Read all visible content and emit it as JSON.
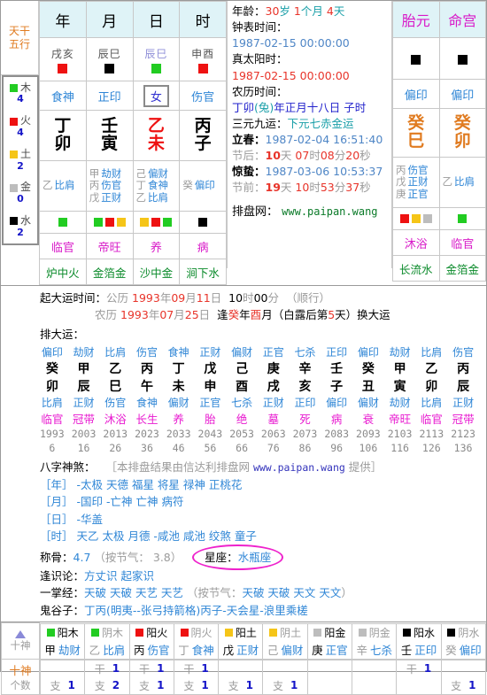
{
  "colors": {
    "wood": "#22cc22",
    "fire": "#ee1111",
    "earth": "#f5c518",
    "metal": "#bdbdbd",
    "water": "#000000",
    "accent_pink": "#ee22cc",
    "link_green": "#0a7a28"
  },
  "wuxing_header": {
    "line1": "天干",
    "line2": "五行"
  },
  "wuxing": [
    {
      "name": "木",
      "count": "4",
      "color": "#22cc22"
    },
    {
      "name": "火",
      "count": "4",
      "color": "#ee1111"
    },
    {
      "name": "土",
      "count": "2",
      "color": "#f5c518"
    },
    {
      "name": "金",
      "count": "0",
      "color": "#bdbdbd"
    },
    {
      "name": "水",
      "count": "2",
      "color": "#000000"
    }
  ],
  "pillars": {
    "headers": [
      "年",
      "月",
      "日",
      "时"
    ],
    "kongwang": [
      {
        "text": "戌亥",
        "color": "#ee1111",
        "highlight": false
      },
      {
        "text": "辰巳",
        "color": "#000000",
        "highlight": false
      },
      {
        "text": "辰巳",
        "color": "#22cc22",
        "highlight": true
      },
      {
        "text": "申酉",
        "color": "#ee1111",
        "highlight": false
      }
    ],
    "shishen": [
      "食神",
      "正印",
      "女",
      "伤官"
    ],
    "ganzhi": [
      {
        "gan": "丁",
        "zhi": "卯",
        "gan_color": "#000000",
        "zhi_color": "#000000"
      },
      {
        "gan": "壬",
        "zhi": "寅",
        "gan_color": "#000000",
        "zhi_color": "#000000"
      },
      {
        "gan": "乙",
        "zhi": "未",
        "gan_color": "#ee1111",
        "zhi_color": "#ee1111"
      },
      {
        "gan": "丙",
        "zhi": "子",
        "gan_color": "#000000",
        "zhi_color": "#000000"
      }
    ],
    "canggan": [
      [
        {
          "g": "乙",
          "s": "比肩"
        }
      ],
      [
        {
          "g": "甲",
          "s": "劫财"
        },
        {
          "g": "丙",
          "s": "伤官"
        },
        {
          "g": "戊",
          "s": "正财"
        }
      ],
      [
        {
          "g": "己",
          "s": "偏财"
        },
        {
          "g": "丁",
          "s": "食神"
        },
        {
          "g": "乙",
          "s": "比肩"
        }
      ],
      [
        {
          "g": "癸",
          "s": "偏印"
        }
      ]
    ],
    "marks": [
      [
        "#22cc22"
      ],
      [
        "#22cc22",
        "#ee1111",
        "#f5c518"
      ],
      [
        "#f5c518",
        "#ee1111",
        "#22cc22"
      ],
      [
        "#000000"
      ]
    ],
    "zhangsheng": [
      "临官",
      "帝旺",
      "养",
      "病"
    ],
    "nayin": [
      "炉中火",
      "金箔金",
      "沙中金",
      "涧下水"
    ]
  },
  "extra": {
    "headers": [
      "胎元",
      "命宫"
    ],
    "kongwang_colors": [
      "#000000",
      "#000000"
    ],
    "shishen": [
      "偏印",
      "偏印"
    ],
    "ganzhi": [
      {
        "gan": "癸",
        "zhi": "巳"
      },
      {
        "gan": "癸",
        "zhi": "卯"
      }
    ],
    "canggan": [
      [
        {
          "g": "丙",
          "s": "伤官"
        },
        {
          "g": "戊",
          "s": "正财"
        },
        {
          "g": "庚",
          "s": "正官"
        }
      ],
      [
        {
          "g": "乙",
          "s": "比肩"
        }
      ]
    ],
    "marks": [
      [
        "#ee1111",
        "#f5c518",
        "#bdbdbd"
      ],
      [
        "#22cc22"
      ]
    ],
    "zhangsheng": [
      "沐浴",
      "临官"
    ],
    "nayin": [
      "长流水",
      "金箔金"
    ]
  },
  "info": {
    "age_label": "年龄：",
    "age_years": "30",
    "age_years_unit": "岁",
    "age_months": "1",
    "age_months_unit": "个月",
    "age_days": "4",
    "age_days_unit": "天",
    "clock_label": "钟表时间：",
    "clock_value": "1987-02-15 00:00:00",
    "solar_label": "真太阳时：",
    "solar_value": "1987-02-15 00:00:00",
    "lunar_label": "农历时间：",
    "lunar_gz": "丁卯",
    "lunar_zodiac": "(兔)",
    "lunar_rest": "年正月十八日 子时",
    "sanyuan_label": "三元九运：",
    "sanyuan_value": "下元七赤金运",
    "lichun_label": "立春：",
    "lichun_value": "1987-02-04 16:51:40",
    "jiehou_label": "节后：",
    "jiehou_d": "10",
    "jiehou_d_unit": "天",
    "jiehou_h": "07",
    "jiehou_h_unit": "时",
    "jiehou_m": "08",
    "jiehou_m_unit": "分",
    "jiehou_s": "20",
    "jiehou_s_unit": "秒",
    "jingzhe_label": "惊蛰：",
    "jingzhe_value": "1987-03-06 10:53:37",
    "jieqian_label": "节前：",
    "jieqian_d": "19",
    "jieqian_d_unit": "天",
    "jieqian_h": "10",
    "jieqian_h_unit": "时",
    "jieqian_m": "53",
    "jieqian_m_unit": "分",
    "jieqian_s": "37",
    "jieqian_s_unit": "秒",
    "paipan_label": "排盘网：",
    "paipan_link": "www.paipan.wang"
  },
  "dayun_start": {
    "label": "起大运时间：",
    "gongli_key": "公历",
    "gongli_y": "1993",
    "gongli_y_u": "年",
    "gongli_m": "09",
    "gongli_m_u": "月",
    "gongli_d": "11",
    "gongli_d_u": "日",
    "gongli_h": "10",
    "gongli_h_u": "时",
    "gongli_min": "00",
    "gongli_min_u": "分",
    "direction": "（顺行）",
    "nongli_key": "农历",
    "nongli_y": "1993",
    "nongli_y_u": "年",
    "nongli_m": "07",
    "nongli_m_u": "月",
    "nongli_d": "25",
    "nongli_d_u": "日",
    "nongli_tail_pre": "逢",
    "nongli_gan": "癸",
    "nongli_gan_u": "年",
    "nongli_zhi": "酉",
    "nongli_zhi_u": "月",
    "nongli_note_a": "（白露后第",
    "nongli_note_n": "5",
    "nongli_note_b": "天）换大运",
    "pai_label": "排大运："
  },
  "dayun": {
    "shishen_top": [
      "偏印",
      "劫财",
      "比肩",
      "伤官",
      "食神",
      "正财",
      "偏财",
      "正官",
      "七杀",
      "正印",
      "偏印",
      "劫财",
      "比肩",
      "伤官"
    ],
    "gan": [
      "癸",
      "甲",
      "乙",
      "丙",
      "丁",
      "戊",
      "己",
      "庚",
      "辛",
      "壬",
      "癸",
      "甲",
      "乙",
      "丙"
    ],
    "zhi": [
      "卯",
      "辰",
      "巳",
      "午",
      "未",
      "申",
      "酉",
      "戌",
      "亥",
      "子",
      "丑",
      "寅",
      "卯",
      "辰"
    ],
    "shishen_bottom": [
      "比肩",
      "正财",
      "伤官",
      "食神",
      "偏财",
      "正官",
      "七杀",
      "正财",
      "正印",
      "偏印",
      "偏财",
      "劫财",
      "比肩",
      "正财"
    ],
    "zhangsheng": [
      "临官",
      "冠带",
      "沐浴",
      "长生",
      "养",
      "胎",
      "绝",
      "墓",
      "死",
      "病",
      "衰",
      "帝旺",
      "临官",
      "冠带"
    ],
    "years": [
      "1993",
      "2003",
      "2013",
      "2023",
      "2033",
      "2043",
      "2053",
      "2063",
      "2073",
      "2083",
      "2093",
      "2103",
      "2113",
      "2123"
    ],
    "ages": [
      "6",
      "16",
      "26",
      "36",
      "46",
      "56",
      "66",
      "76",
      "86",
      "96",
      "106",
      "116",
      "126",
      "136"
    ]
  },
  "shensha": {
    "title": "八字神煞：",
    "credit_a": "［本排盘结果由信达利排盘网",
    "credit_link": "www.paipan.wang",
    "credit_b": "提供］",
    "rows": [
      {
        "key": "［年］",
        "value": "-太极 天德 福星 将星 禄神 正桃花"
      },
      {
        "key": "［月］",
        "value": "-国印 -亡神 亡神 病符"
      },
      {
        "key": "［日］",
        "value": "-华盖"
      },
      {
        "key": "［时］",
        "value": "天乙 太极 月德 -咸池 咸池 绞煞 童子"
      }
    ]
  },
  "misc": {
    "chenggu_label": "称骨：",
    "chenggu_value": "4.7",
    "chenggu_note": "（按节气： 3.8）",
    "xingzuo_label": "星座：",
    "xingzuo_value": "水瓶座",
    "fengshi_label": "逢识论：",
    "fengshi_value": "方丈识 起家识",
    "yizhang_label": "一掌经：",
    "yizhang_value": "天破 天破 天艺 天艺",
    "yizhang_note": "（按节气：",
    "yizhang_note_val": "天破 天破 天文 天文",
    "yizhang_note_end": "）",
    "guiguzi_label": "鬼谷子：",
    "guiguzi_value": "丁丙(明夷--张弓持箭格)丙子-天会星-浪里乘槎"
  },
  "bottom_table": {
    "hdr_row1_label": "十神",
    "hdr_row2_line1": "十神",
    "hdr_row2_line2": "个数",
    "columns": [
      {
        "yy": "阳木",
        "color": "#22cc22",
        "gan": "甲",
        "ss": "劫财",
        "dim": false,
        "gan_count": "",
        "zhi_count": "1"
      },
      {
        "yy": "阴木",
        "color": "#22cc22",
        "gan": "乙",
        "ss": "比肩",
        "dim": true,
        "gan_count": "1",
        "zhi_count": "2"
      },
      {
        "yy": "阳火",
        "color": "#ee1111",
        "gan": "丙",
        "ss": "伤官",
        "dim": false,
        "gan_count": "1",
        "zhi_count": "1"
      },
      {
        "yy": "阴火",
        "color": "#ee1111",
        "gan": "丁",
        "ss": "食神",
        "dim": true,
        "gan_count": "1",
        "zhi_count": "1"
      },
      {
        "yy": "阳土",
        "color": "#f5c518",
        "gan": "戊",
        "ss": "正财",
        "dim": false,
        "gan_count": "",
        "zhi_count": "1"
      },
      {
        "yy": "阴土",
        "color": "#f5c518",
        "gan": "己",
        "ss": "偏财",
        "dim": true,
        "gan_count": "",
        "zhi_count": "1"
      },
      {
        "yy": "阳金",
        "color": "#bdbdbd",
        "gan": "庚",
        "ss": "正官",
        "dim": false,
        "gan_count": "",
        "zhi_count": ""
      },
      {
        "yy": "阴金",
        "color": "#bdbdbd",
        "gan": "辛",
        "ss": "七杀",
        "dim": true,
        "gan_count": "",
        "zhi_count": ""
      },
      {
        "yy": "阳水",
        "color": "#000000",
        "gan": "壬",
        "ss": "正印",
        "dim": false,
        "gan_count": "1",
        "zhi_count": ""
      },
      {
        "yy": "阴水",
        "color": "#000000",
        "gan": "癸",
        "ss": "偏印",
        "dim": true,
        "gan_count": "",
        "zhi_count": "1"
      }
    ],
    "gan_key": "干",
    "zhi_key": "支"
  }
}
